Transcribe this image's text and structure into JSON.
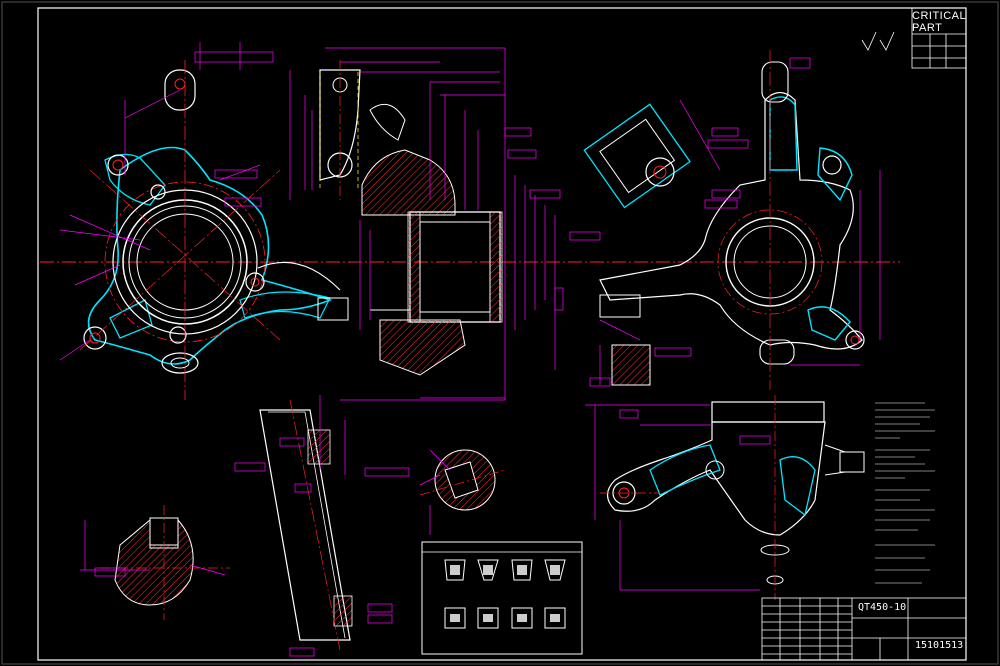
{
  "drawing": {
    "material": "QT450-10",
    "drawing_number": "15101513",
    "critical_label_line1": "CRITICAL",
    "critical_label_line2": "PART"
  },
  "colors": {
    "background": "#000000",
    "frame": "#ffffff",
    "dimension": "#ff00ff",
    "outline": "#ffffff",
    "center_line": "#ff2020",
    "contour": "#00e5ff",
    "hatch": "#ff3030"
  }
}
